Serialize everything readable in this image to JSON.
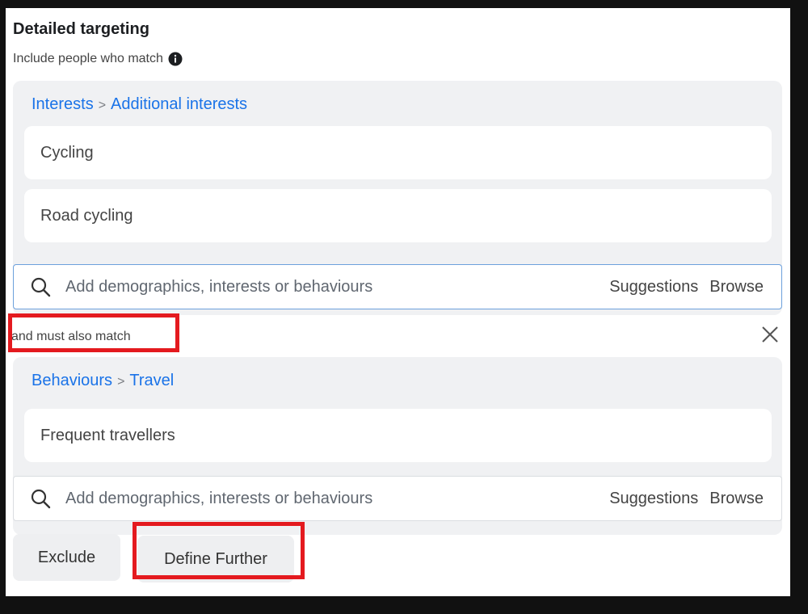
{
  "header": {
    "title": "Detailed targeting",
    "subtitle": "Include people who match"
  },
  "include_group": {
    "breadcrumb": [
      "Interests",
      "Additional interests"
    ],
    "separator": ">",
    "items": [
      "Cycling",
      "Road cycling"
    ],
    "search": {
      "placeholder": "Add demographics, interests or behaviours",
      "suggestions_label": "Suggestions",
      "browse_label": "Browse"
    }
  },
  "narrow_label": "and must also match",
  "narrow_group": {
    "breadcrumb": [
      "Behaviours",
      "Travel"
    ],
    "separator": ">",
    "items": [
      "Frequent travellers"
    ],
    "search": {
      "placeholder": "Add demographics, interests or behaviours",
      "suggestions_label": "Suggestions",
      "browse_label": "Browse"
    }
  },
  "actions": {
    "exclude_label": "Exclude",
    "define_further_label": "Define Further"
  },
  "colors": {
    "link_blue": "#1a73e8",
    "highlight_red": "#e41a1f",
    "group_bg": "#f0f1f3"
  },
  "icons": [
    "info-icon",
    "search-icon",
    "close-icon"
  ]
}
